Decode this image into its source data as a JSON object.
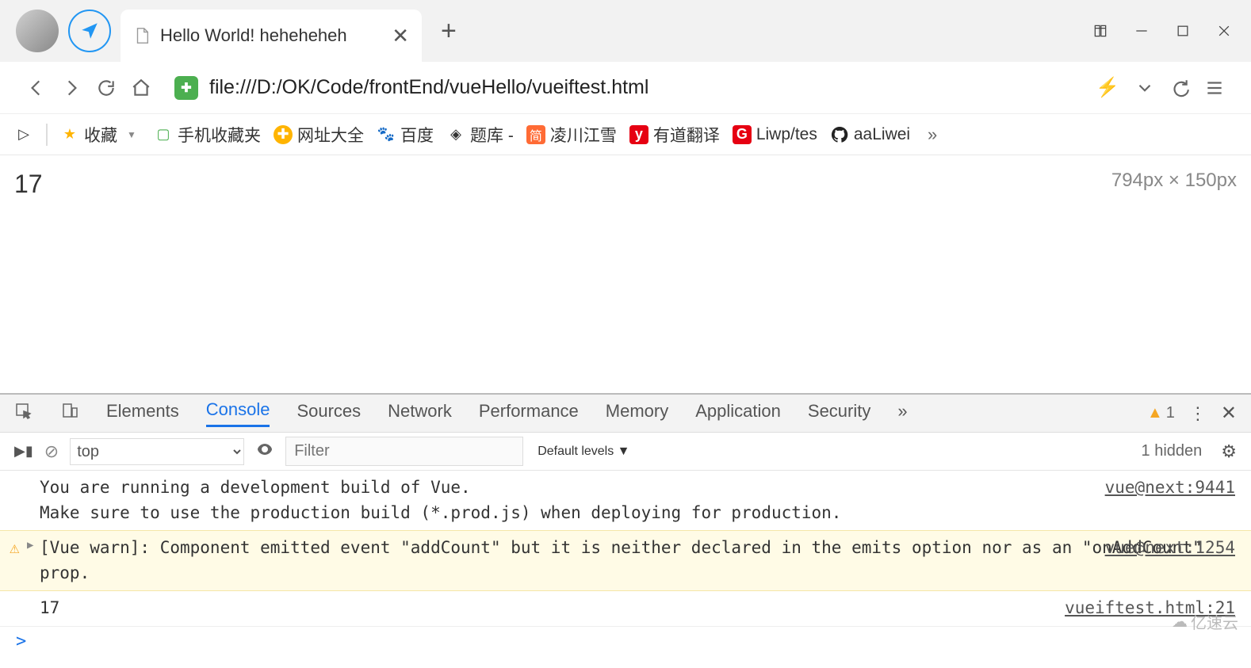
{
  "tab": {
    "title": "Hello World! heheheheh"
  },
  "url": "file:///D:/OK/Code/frontEnd/vueHello/vueiftest.html",
  "bookmarks": {
    "fav": "收藏",
    "mobile": "手机收藏夹",
    "wangzhi": "网址大全",
    "baidu": "百度",
    "tiku": "题库 -",
    "lingchuan": "凌川江雪",
    "youdao": "有道翻译",
    "liwp": "Liwp/tes",
    "aaliwei": "aaLiwei"
  },
  "page": {
    "output": "17",
    "dimensions": "794px × 150px"
  },
  "devtools": {
    "tabs": {
      "elements": "Elements",
      "console": "Console",
      "sources": "Sources",
      "network": "Network",
      "performance": "Performance",
      "memory": "Memory",
      "application": "Application",
      "security": "Security"
    },
    "warn_count": "1",
    "toolbar": {
      "context": "top",
      "filter_placeholder": "Filter",
      "levels": "Default levels ▼",
      "hidden": "1 hidden"
    },
    "messages": {
      "info_line1": "You are running a development build of Vue.",
      "info_line2": "Make sure to use the production build (*.prod.js) when deploying for production.",
      "info_src": "vue@next:9441",
      "warn_text": "[Vue warn]: Component emitted event \"addCount\" but it is neither declared in the emits option nor as an \"onAddCount\" prop.",
      "warn_src": "vue@next:1254",
      "log_text": "17",
      "log_src": "vueiftest.html:21"
    },
    "prompt": ">"
  },
  "watermark": "亿速云"
}
